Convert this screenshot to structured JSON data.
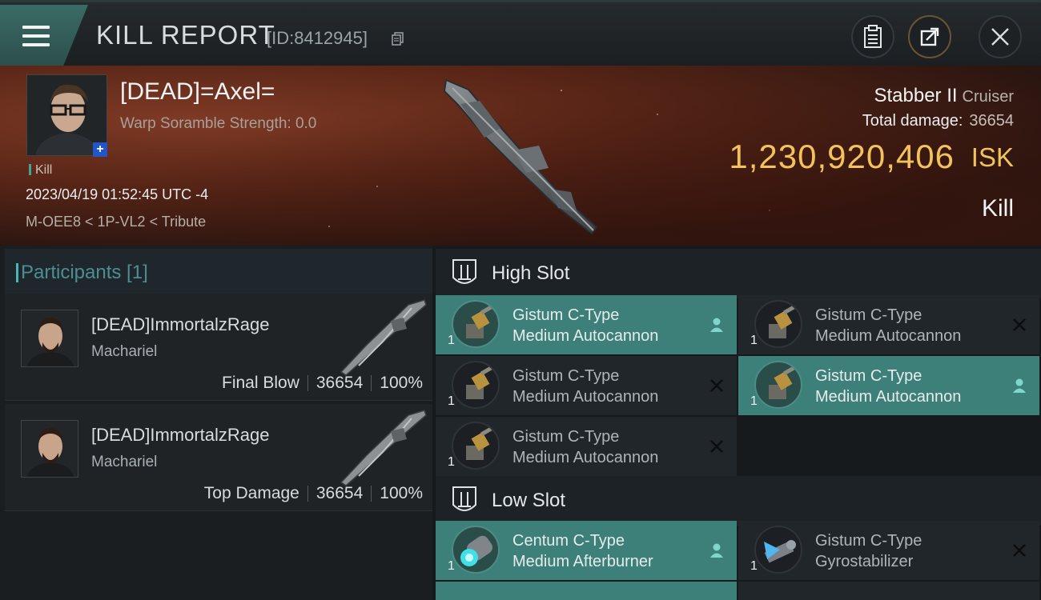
{
  "header": {
    "title": "KILL REPORT",
    "report_id": "[ID:8412945]",
    "buttons": [
      "clipboard",
      "share",
      "close"
    ]
  },
  "victim": {
    "name": "[DEAD]=Axel=",
    "scramble": "Warp Soramble Strength: 0.0",
    "kill_tag": "Kill",
    "datetime": "2023/04/19 01:52:45 UTC -4",
    "location": "M-OEE8 < 1P-VL2 < Tribute",
    "ship": "Stabber II",
    "ship_class": "Cruiser",
    "total_damage_label": "Total damage:",
    "total_damage": "36654",
    "isk_value": "1,230,920,406",
    "isk_unit": "ISK",
    "result": "Kill"
  },
  "participants": {
    "title": "Participants [1]",
    "items": [
      {
        "name": "[DEAD]ImmortalzRage",
        "ship": "Machariel",
        "role": "Final Blow",
        "damage": "36654",
        "percent": "100%"
      },
      {
        "name": "[DEAD]ImmortalzRage",
        "ship": "Machariel",
        "role": "Top Damage",
        "damage": "36654",
        "percent": "100%"
      }
    ]
  },
  "high_slot": {
    "title": "High Slot",
    "modules": [
      {
        "line1": "Gistum C-Type",
        "line2": "Medium Autocannon",
        "qty": "1",
        "status": "fitted"
      },
      {
        "line1": "Gistum C-Type",
        "line2": "Medium Autocannon",
        "qty": "1",
        "status": "destroyed"
      },
      {
        "line1": "Gistum C-Type",
        "line2": "Medium Autocannon",
        "qty": "1",
        "status": "destroyed"
      },
      {
        "line1": "Gistum C-Type",
        "line2": "Medium Autocannon",
        "qty": "1",
        "status": "fitted"
      },
      {
        "line1": "Gistum C-Type",
        "line2": "Medium Autocannon",
        "qty": "1",
        "status": "destroyed"
      }
    ]
  },
  "low_slot": {
    "title": "Low Slot",
    "modules": [
      {
        "line1": "Centum C-Type",
        "line2": "Medium Afterburner",
        "qty": "1",
        "status": "fitted"
      },
      {
        "line1": "Gistum C-Type",
        "line2": "Gyrostabilizer",
        "qty": "1",
        "status": "destroyed"
      }
    ]
  },
  "colors": {
    "accent_teal": "#3d807a",
    "isk_gold": "#f2c35a",
    "hero_red": "#5a2617"
  }
}
